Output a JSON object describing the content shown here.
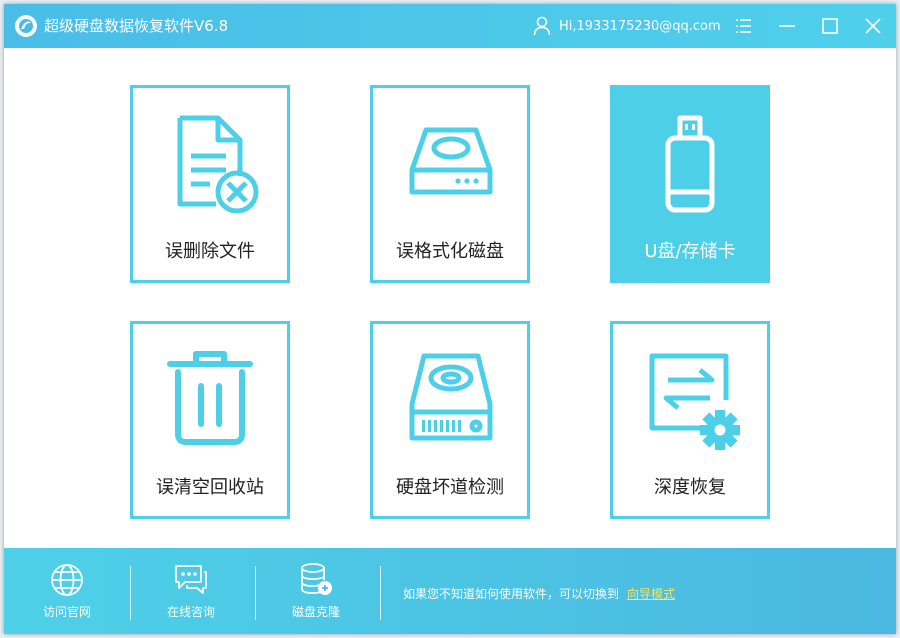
{
  "window": {
    "title": "超级硬盘数据恢复软件V6.8",
    "user": "Hi,1933175230@qq.com",
    "controls": [
      "menu-icon",
      "minimize-icon",
      "maximize-icon",
      "close-icon"
    ]
  },
  "tiles": [
    {
      "label": "误删除文件",
      "icon": "deleted-file-icon",
      "active": false
    },
    {
      "label": "误格式化磁盘",
      "icon": "hard-disk-icon",
      "active": false
    },
    {
      "label": "U盘/存储卡",
      "icon": "usb-drive-icon",
      "active": true
    },
    {
      "label": "误清空回收站",
      "icon": "trash-bin-icon",
      "active": false
    },
    {
      "label": "硬盘坏道检测",
      "icon": "disk-scan-icon",
      "active": false
    },
    {
      "label": "深度恢复",
      "icon": "deep-recovery-icon",
      "active": false
    }
  ],
  "bottom": {
    "items": [
      {
        "label": "访问官网",
        "icon": "globe-icon"
      },
      {
        "label": "在线咨询",
        "icon": "chat-icon"
      },
      {
        "label": "磁盘克隆",
        "icon": "disk-clone-icon"
      }
    ],
    "hint": "如果您不知道如何使用软件，可以切换到",
    "hint_link": "向导模式"
  },
  "colors": {
    "accent": "#4ecfe8",
    "titlebar": "#49bde8",
    "link": "#f5e663"
  }
}
